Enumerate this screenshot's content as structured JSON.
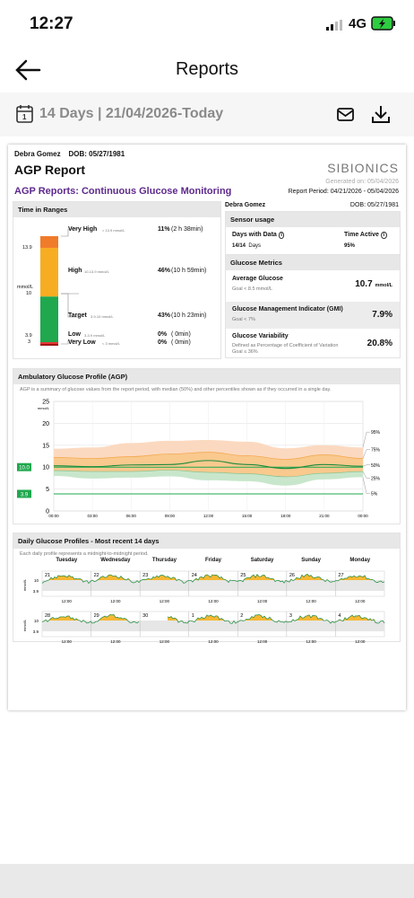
{
  "status_bar": {
    "time": "12:27",
    "network": "4G"
  },
  "nav": {
    "title": "Reports"
  },
  "date_bar": {
    "range": "14 Days | 21/04/2026-Today"
  },
  "report": {
    "patient_name": "Debra Gomez",
    "dob": "DOB: 05/27/1981",
    "title": "AGP Report",
    "brand": "SIBIONICS",
    "generated": "Generated on: 05/04/2026",
    "subtitle": "AGP Reports: Continuous Glucose Monitoring",
    "period": "Report Period: 04/21/2026 - 05/04/2026",
    "time_in_ranges": {
      "header": "Time in Ranges",
      "axis": {
        "t1": "13.9",
        "unit1": "mmol/L",
        "unit2": "10",
        "t3": "3.9",
        "t4": "3"
      },
      "rows": [
        {
          "label": "Very High",
          "range": "> 13.9 mmol/L",
          "pct": "11%",
          "time": "(2 h 38min)"
        },
        {
          "label": "High",
          "range": "10-13.9 mmol/L",
          "pct": "46%",
          "time": "(10 h 59min)"
        },
        {
          "label": "Target",
          "range": "3.9-10 mmol/L",
          "pct": "43%",
          "time": "(10 h 23min)"
        },
        {
          "label": "Low",
          "range": "3-3.9 mmol/L",
          "pct": "0%",
          "time": "( 0min)"
        },
        {
          "label": "Very Low",
          "range": "< 3 mmol/L",
          "pct": "0%",
          "time": "( 0min)"
        }
      ],
      "fractions": {
        "very_high": 0.11,
        "high": 0.46,
        "target": 0.43,
        "low": 0.0,
        "very_low": 0.0
      },
      "colors": {
        "very_high": "#f07b2a",
        "high": "#f7ad22",
        "target": "#1fa84e",
        "low": "#e53935",
        "very_low": "#a31515"
      }
    },
    "sensor_usage": {
      "header": "Sensor usage",
      "days_label": "Days with Data",
      "days_value": "14/14",
      "days_unit": "Days",
      "active_label": "Time Active",
      "active_value": "95%"
    },
    "glucose_metrics": {
      "header": "Glucose Metrics",
      "items": [
        {
          "label": "Average Glucose",
          "goal": "Goal < 8.5 mmol/L",
          "value": "10.7",
          "unit": "mmol/L"
        },
        {
          "label": "Glucose Management Indicator (GMI)",
          "goal": "Goal < 7%",
          "value": "7.9%",
          "unit": ""
        },
        {
          "label": "Glucose Variability",
          "goal": "Defined as Percentage of Coefficient of Variation",
          "goal2": "Goal ≤ 36%",
          "value": "20.8%",
          "unit": ""
        }
      ]
    },
    "agp": {
      "header": "Ambulatory Glucose Profile (AGP)",
      "desc": "AGP is a summary of glucose values from the report period, with median (50%) and other percentiles shown as if they occurred in a single day.",
      "y_unit": "mmol/L",
      "y_ticks": [
        "25",
        "20",
        "15",
        "10",
        "5",
        "0"
      ],
      "x_ticks": [
        "00:00",
        "03:00",
        "06:00",
        "09:00",
        "12:00",
        "15:00",
        "18:00",
        "21:00",
        "00:00"
      ],
      "target_high": "10.0",
      "target_low": "3.9",
      "percentile_labels": [
        "95%",
        "75%",
        "50%",
        "25%",
        "5%"
      ]
    },
    "daily": {
      "header": "Daily Glucose Profiles - Most recent 14 days",
      "desc": "Each daily profile represents a midnight-to-midnight period.",
      "weekdays": [
        "Tuesday",
        "Wednesday",
        "Thursday",
        "Friday",
        "Saturday",
        "Sunday",
        "Monday"
      ],
      "week1_dates": [
        "21",
        "22",
        "23",
        "24",
        "25",
        "26",
        "27"
      ],
      "week2_dates": [
        "28",
        "29",
        "30",
        "1",
        "2",
        "3",
        "4"
      ],
      "noon": "12:00",
      "unit": "mmol/L",
      "y10": "10",
      "y39": "3.9"
    }
  },
  "chart_data": {
    "type": "area",
    "title": "Ambulatory Glucose Profile (AGP)",
    "xlabel": "",
    "ylabel": "mmol/L",
    "x": [
      "00:00",
      "03:00",
      "06:00",
      "09:00",
      "12:00",
      "15:00",
      "18:00",
      "21:00",
      "00:00"
    ],
    "ylim": [
      0,
      25
    ],
    "series": [
      {
        "name": "95%",
        "values": [
          14.2,
          14.5,
          15.5,
          16.0,
          16.2,
          15.8,
          14.3,
          15.0,
          14.5
        ]
      },
      {
        "name": "75%",
        "values": [
          12.2,
          12.0,
          12.4,
          13.0,
          13.4,
          12.6,
          11.8,
          12.8,
          12.0
        ]
      },
      {
        "name": "50%",
        "values": [
          10.3,
          10.1,
          10.5,
          10.6,
          11.5,
          10.6,
          9.7,
          10.6,
          10.2
        ]
      },
      {
        "name": "25%",
        "values": [
          9.2,
          9.0,
          9.0,
          9.3,
          8.8,
          8.5,
          7.8,
          8.6,
          9.0
        ]
      },
      {
        "name": "5%",
        "values": [
          8.0,
          7.4,
          7.6,
          7.9,
          7.0,
          6.8,
          5.8,
          7.2,
          7.7
        ]
      }
    ]
  }
}
